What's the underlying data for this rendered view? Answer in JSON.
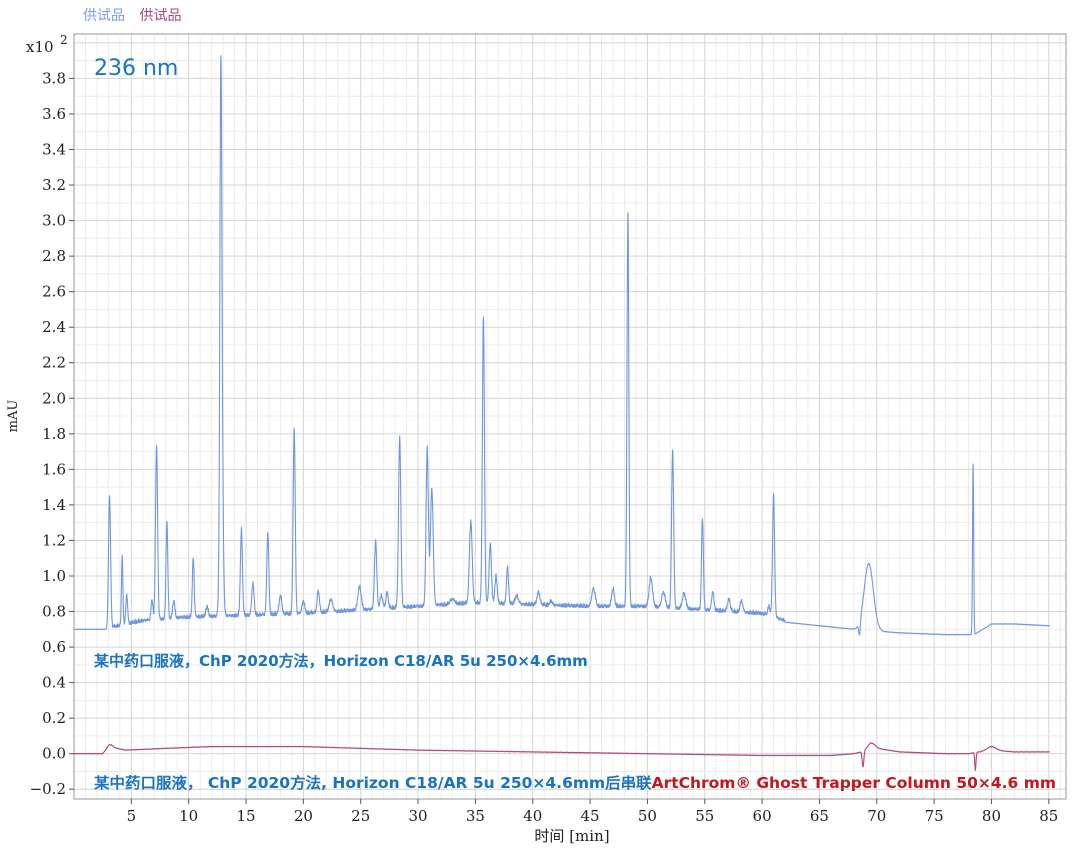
{
  "legend": [
    {
      "label": "供试品",
      "color": "#7a9de0"
    },
    {
      "label": "供试品",
      "color": "#b0457f"
    }
  ],
  "chart_data": {
    "type": "line",
    "xlabel": "时间 [min]",
    "ylabel": "mAU",
    "y_scale_label": "x10",
    "y_scale_exponent": "2",
    "xlim": [
      0,
      86.5
    ],
    "ylim": [
      -0.255,
      4.05
    ],
    "x_ticks": [
      5,
      10,
      15,
      20,
      25,
      30,
      35,
      40,
      45,
      50,
      55,
      60,
      65,
      70,
      75,
      80,
      85
    ],
    "x_tick_labels": [
      "5",
      "10",
      "15",
      "20",
      "25",
      "30",
      "35",
      "40",
      "45",
      "50",
      "55",
      "60",
      "65",
      "70",
      "75",
      "80",
      "85"
    ],
    "y_ticks": [
      -0.2,
      0.0,
      0.2,
      0.4,
      0.6,
      0.8,
      1.0,
      1.2,
      1.4,
      1.6,
      1.8,
      2.0,
      2.2,
      2.4,
      2.6,
      2.8,
      3.0,
      3.2,
      3.4,
      3.6,
      3.8
    ],
    "y_tick_labels": [
      "-0.2",
      "0.0",
      "0.2",
      "0.4",
      "0.6",
      "0.8",
      "1.0",
      "1.2",
      "1.4",
      "1.6",
      "1.8",
      "2.0",
      "2.2",
      "2.4",
      "2.6",
      "2.8",
      "3.0",
      "3.2",
      "3.4",
      "3.6",
      "3.8"
    ],
    "grid": true,
    "annotations": {
      "wavelength": "236 nm",
      "upper_label": "某中药口服液，ChP 2020方法，Horizon C18/AR 5u 250×4.6mm",
      "lower_label_part1": "某中药口服液， ChP 2020方法, Horizon C18/AR 5u 250×4.6mm后串联",
      "lower_label_part2": "ArtChrom® Ghost Trapper Column 50×4.6 mm"
    },
    "series": [
      {
        "color": "#6f96e0",
        "baseline": [
          [
            0,
            0.7
          ],
          [
            3,
            0.7
          ],
          [
            6,
            0.74
          ],
          [
            10,
            0.76
          ],
          [
            15,
            0.77
          ],
          [
            20,
            0.78
          ],
          [
            25,
            0.8
          ],
          [
            30,
            0.82
          ],
          [
            35,
            0.84
          ],
          [
            40,
            0.83
          ],
          [
            45,
            0.82
          ],
          [
            50,
            0.82
          ],
          [
            55,
            0.8
          ],
          [
            60,
            0.78
          ],
          [
            62,
            0.74
          ],
          [
            65,
            0.72
          ],
          [
            68,
            0.7
          ],
          [
            72,
            0.68
          ],
          [
            76,
            0.67
          ],
          [
            78.5,
            0.67
          ],
          [
            80,
            0.73
          ],
          [
            82,
            0.73
          ],
          [
            85,
            0.72
          ]
        ],
        "peaks": [
          [
            3.1,
            1.44,
            0.09
          ],
          [
            4.2,
            1.11,
            0.06
          ],
          [
            4.6,
            0.88,
            0.08
          ],
          [
            6.8,
            0.86,
            0.08
          ],
          [
            7.2,
            1.73,
            0.09
          ],
          [
            8.1,
            1.3,
            0.08
          ],
          [
            8.7,
            0.85,
            0.1
          ],
          [
            10.4,
            1.09,
            0.08
          ],
          [
            11.6,
            0.82,
            0.1
          ],
          [
            12.8,
            2.6,
            0.08
          ],
          [
            12.85,
            2.19,
            0.12
          ],
          [
            14.6,
            1.25,
            0.09
          ],
          [
            15.6,
            0.95,
            0.1
          ],
          [
            16.9,
            1.23,
            0.09
          ],
          [
            18.0,
            0.88,
            0.12
          ],
          [
            19.2,
            1.82,
            0.09
          ],
          [
            20.0,
            0.85,
            0.12
          ],
          [
            21.3,
            0.91,
            0.1
          ],
          [
            22.4,
            0.86,
            0.15
          ],
          [
            24.9,
            0.93,
            0.15
          ],
          [
            26.3,
            1.19,
            0.1
          ],
          [
            26.8,
            0.88,
            0.12
          ],
          [
            27.3,
            0.9,
            0.1
          ],
          [
            28.4,
            1.77,
            0.1
          ],
          [
            30.8,
            1.71,
            0.1
          ],
          [
            31.2,
            1.48,
            0.12
          ],
          [
            33.0,
            0.86,
            0.2
          ],
          [
            34.6,
            1.3,
            0.12
          ],
          [
            35.7,
            2.45,
            0.09
          ],
          [
            36.3,
            1.17,
            0.1
          ],
          [
            36.8,
            0.99,
            0.1
          ],
          [
            37.8,
            1.04,
            0.09
          ],
          [
            38.6,
            0.88,
            0.15
          ],
          [
            40.5,
            0.9,
            0.12
          ],
          [
            41.6,
            0.85,
            0.12
          ],
          [
            45.3,
            0.92,
            0.15
          ],
          [
            47.0,
            0.92,
            0.12
          ],
          [
            48.3,
            3.03,
            0.08
          ],
          [
            50.3,
            0.98,
            0.15
          ],
          [
            51.4,
            0.9,
            0.15
          ],
          [
            52.2,
            1.7,
            0.09
          ],
          [
            53.2,
            0.89,
            0.15
          ],
          [
            54.8,
            1.32,
            0.08
          ],
          [
            55.7,
            0.9,
            0.1
          ],
          [
            57.1,
            0.86,
            0.12
          ],
          [
            58.2,
            0.85,
            0.12
          ],
          [
            60.6,
            0.82,
            0.1
          ],
          [
            61.0,
            1.45,
            0.09
          ],
          [
            69.3,
            1.07,
            0.4
          ],
          [
            78.4,
            1.63,
            0.05
          ]
        ],
        "dips": [
          [
            68.5,
            0.08,
            0.07
          ]
        ]
      },
      {
        "color": "#b0457f",
        "baseline": [
          [
            0,
            0.0
          ],
          [
            2.5,
            0.0
          ],
          [
            3.0,
            0.04
          ],
          [
            4.5,
            0.02
          ],
          [
            8,
            0.03
          ],
          [
            12,
            0.04
          ],
          [
            20,
            0.04
          ],
          [
            30,
            0.02
          ],
          [
            40,
            0.01
          ],
          [
            50,
            0.0
          ],
          [
            60,
            -0.01
          ],
          [
            66,
            -0.01
          ],
          [
            68,
            0.0
          ],
          [
            70,
            0.03
          ],
          [
            72,
            0.01
          ],
          [
            76,
            0.0
          ],
          [
            78,
            0.0
          ],
          [
            80,
            0.02
          ],
          [
            82,
            0.01
          ],
          [
            85,
            0.01
          ]
        ],
        "peaks": [
          [
            3.2,
            0.05,
            0.2
          ],
          [
            69.5,
            0.06,
            0.3
          ],
          [
            80,
            0.04,
            0.4
          ]
        ],
        "dips": [
          [
            68.8,
            0.09,
            0.07
          ],
          [
            78.6,
            0.1,
            0.05
          ]
        ]
      }
    ]
  }
}
